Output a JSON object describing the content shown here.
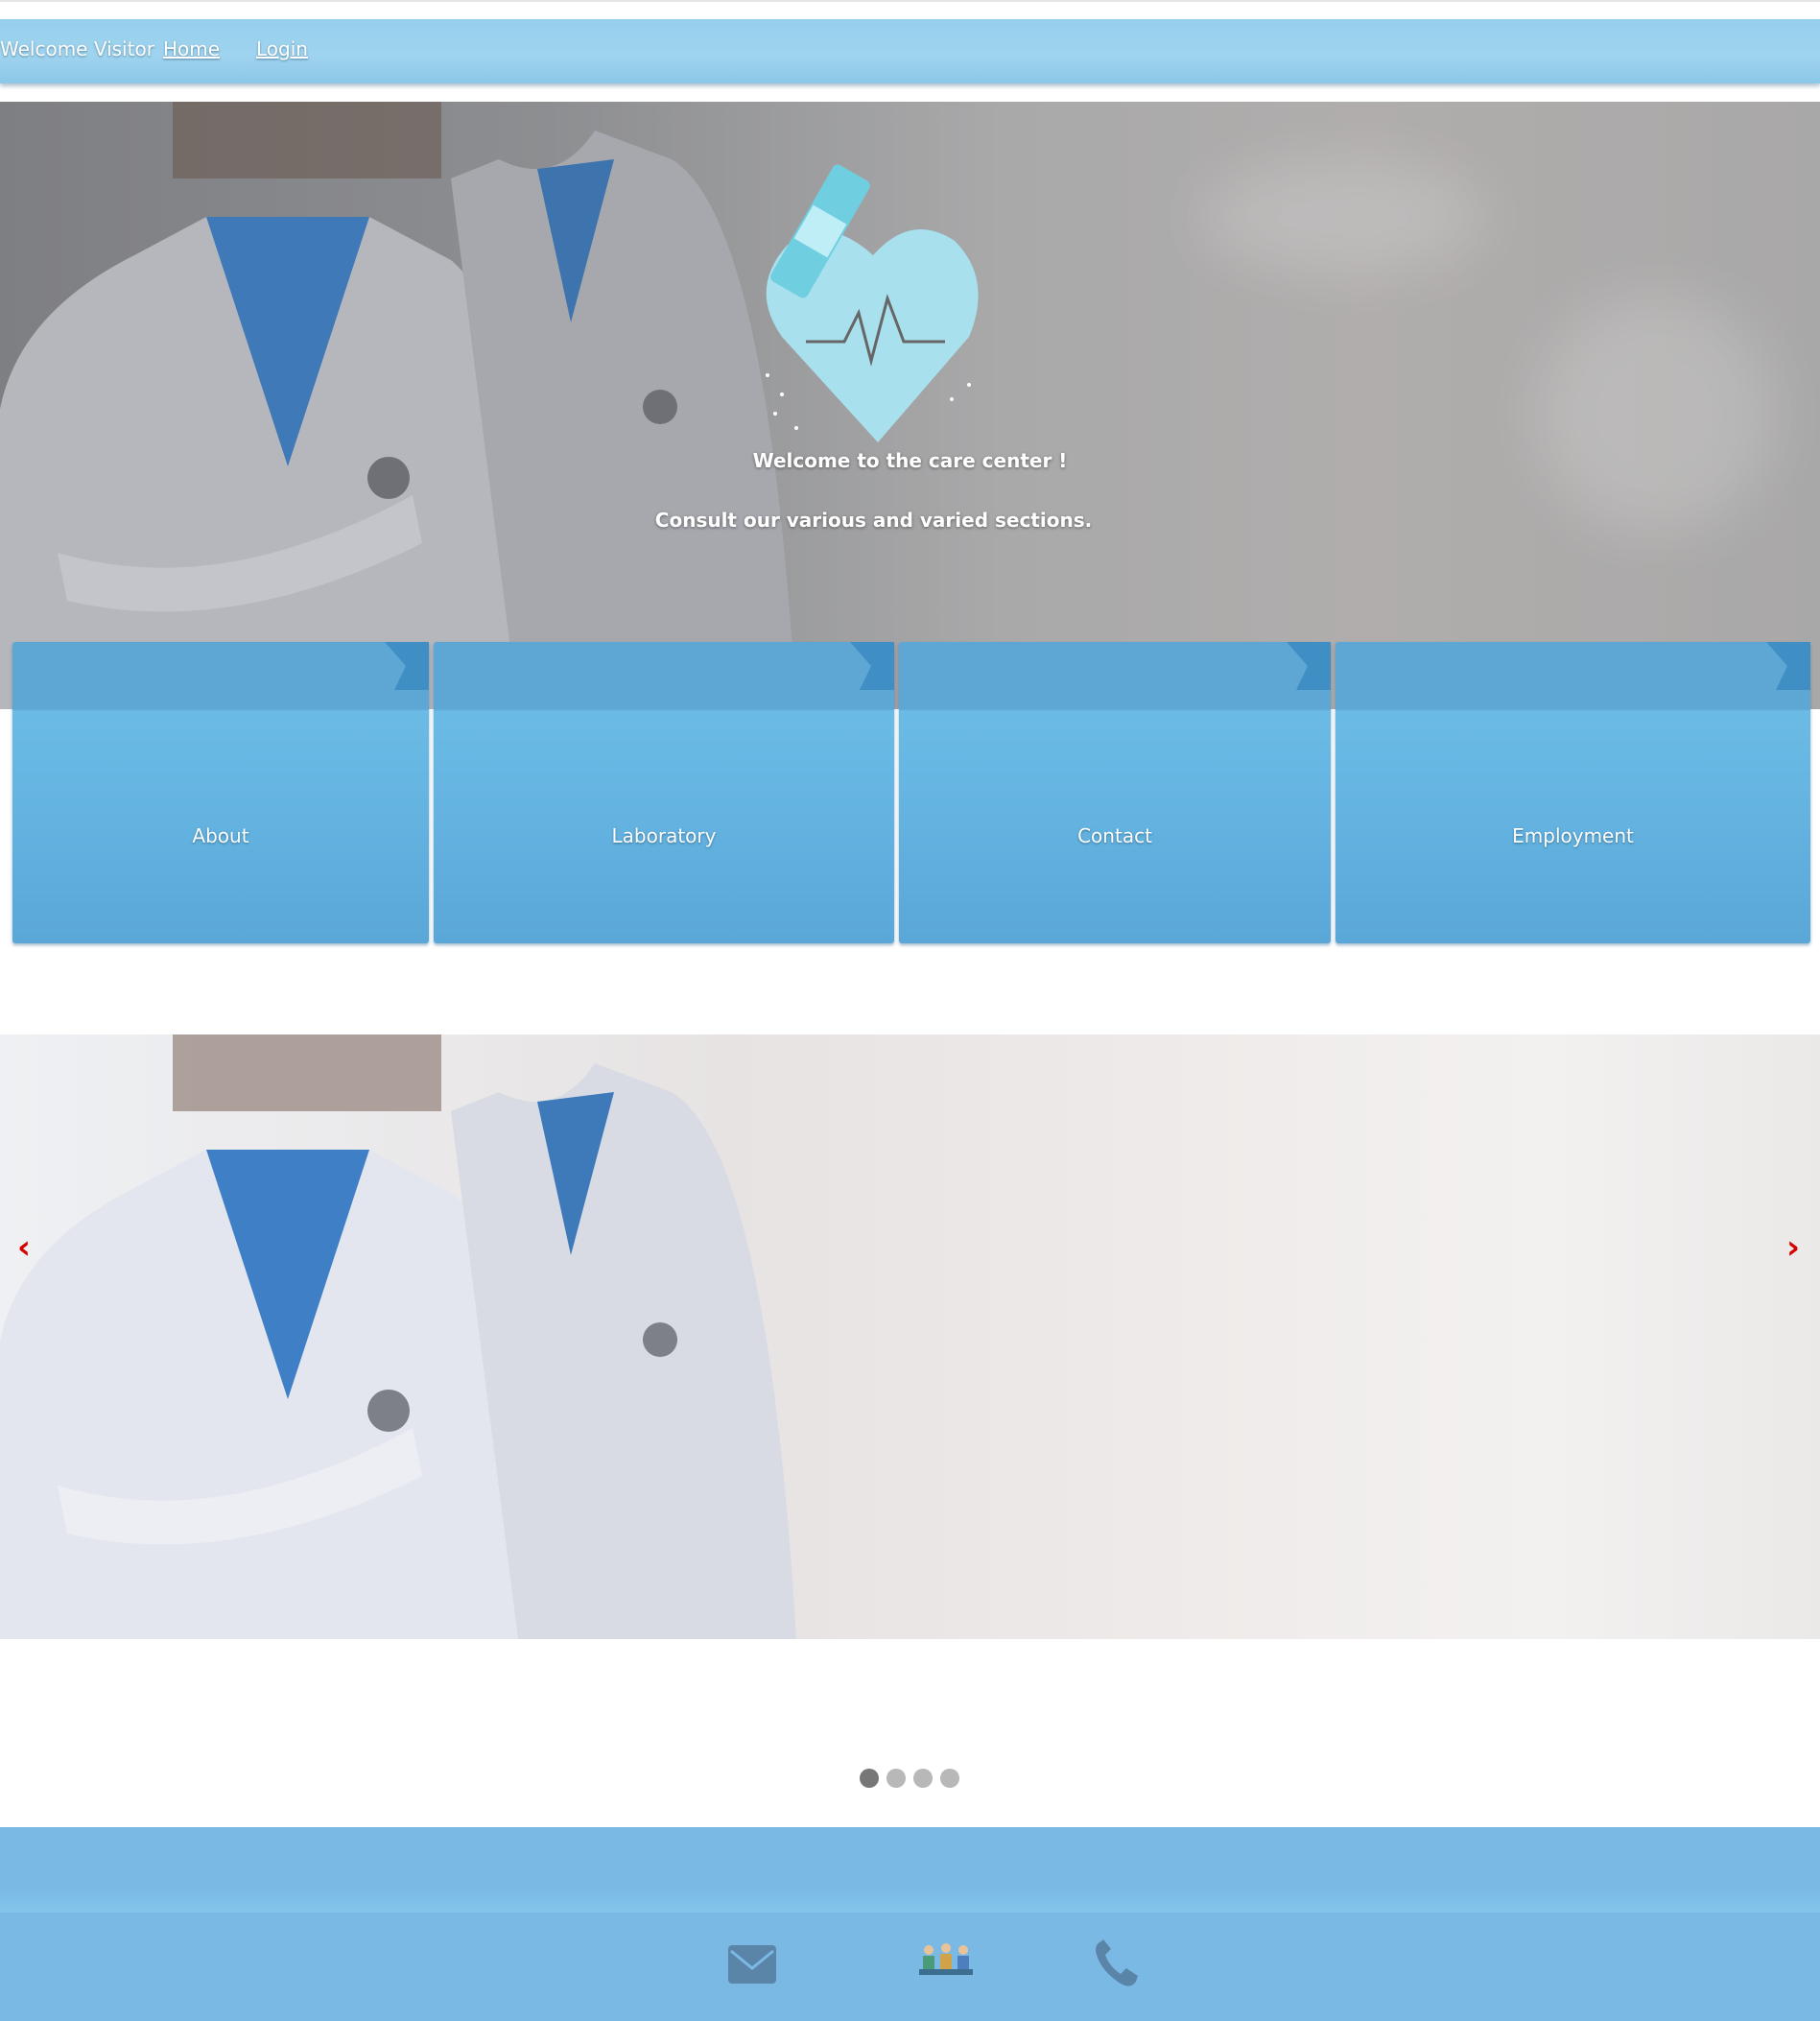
{
  "nav": {
    "welcome": "Welcome Visitor",
    "home": "Home",
    "login": "Login"
  },
  "hero": {
    "title": "Welcome to the care center !",
    "subtitle": "Consult our various and varied sections."
  },
  "tiles": [
    {
      "label": "About"
    },
    {
      "label": "Laboratory"
    },
    {
      "label": "Contact"
    },
    {
      "label": "Employment"
    }
  ],
  "carousel": {
    "prev": "‹",
    "next": "›",
    "slide_count": 4,
    "active_index": 0
  },
  "footer": {
    "icons": [
      "envelope-icon",
      "team-icon",
      "phone-icon"
    ]
  },
  "colors": {
    "navbar": "#9fd4ef",
    "tile": "#63b2e0",
    "footer": "#7ab9e4",
    "arrow": "#d40000"
  }
}
